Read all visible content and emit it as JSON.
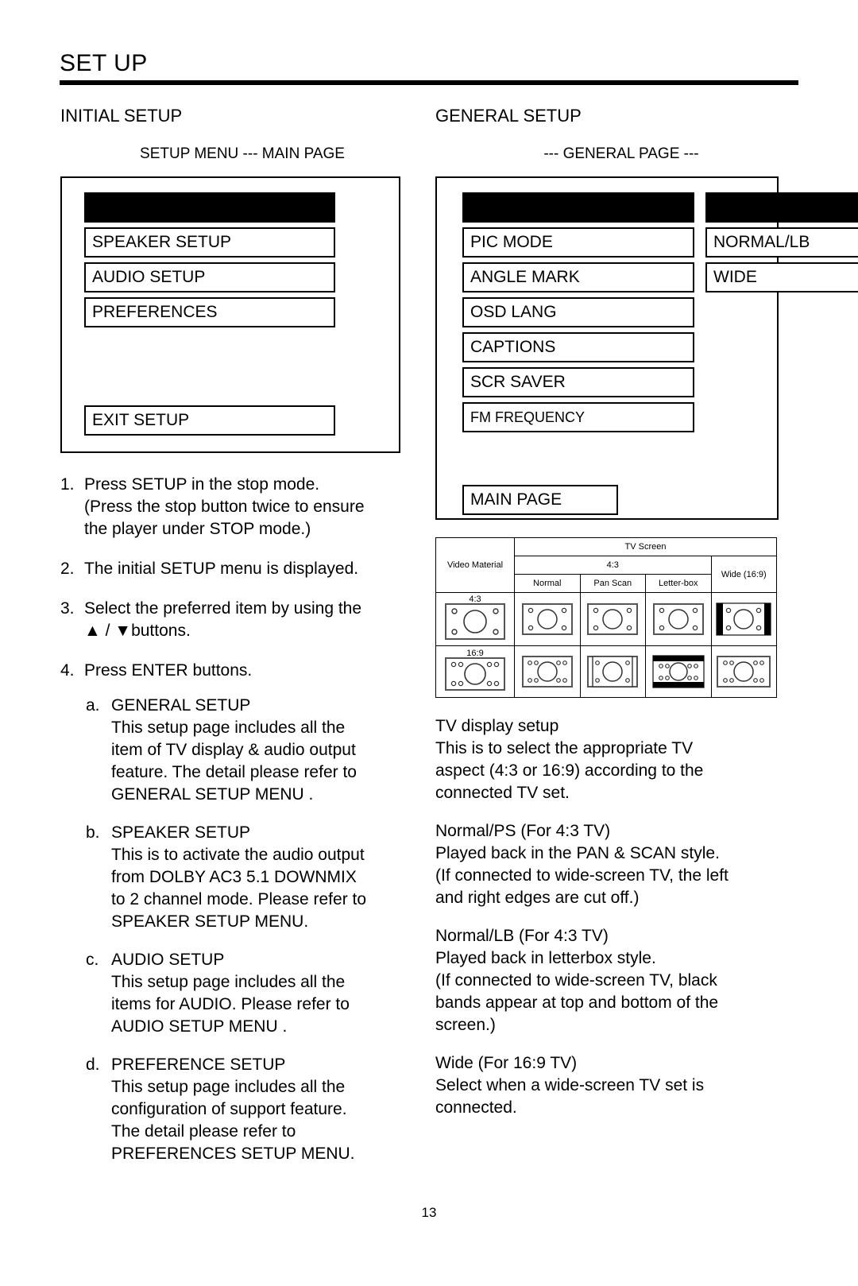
{
  "page": {
    "title": "SET UP",
    "number": "13"
  },
  "left": {
    "section_title": "INITIAL SETUP",
    "sub_title": "SETUP MENU --- MAIN PAGE",
    "osd": {
      "items": [
        "SPEAKER SETUP",
        "AUDIO SETUP",
        "PREFERENCES"
      ],
      "exit": "EXIT SETUP"
    },
    "steps": [
      {
        "num": "1.",
        "lines": [
          "Press SETUP in the stop mode.",
          "(Press the stop button twice to ensure",
          "the player under STOP mode.)"
        ]
      },
      {
        "num": "2.",
        "lines": [
          "The initial SETUP menu is displayed."
        ]
      },
      {
        "num": "3.",
        "lines": [
          "Select the preferred item by using the",
          "▲ / ▼buttons."
        ]
      },
      {
        "num": "4.",
        "lines": [
          "Press ENTER buttons."
        ]
      }
    ],
    "sub_steps": [
      {
        "num": "a.",
        "lines": [
          "GENERAL SETUP",
          "This setup page includes all the",
          "item of TV display & audio output",
          "feature.  The detail please refer to",
          "GENERAL SETUP MENU ."
        ]
      },
      {
        "num": "b.",
        "lines": [
          "SPEAKER SETUP",
          "This is to activate the audio output",
          "from DOLBY AC3 5.1 DOWNMIX",
          "to 2 channel mode.  Please refer to",
          "SPEAKER SETUP MENU."
        ]
      },
      {
        "num": "c.",
        "lines": [
          "AUDIO SETUP",
          "This setup page includes all the",
          "items for AUDIO.  Please refer to",
          "AUDIO SETUP MENU ."
        ]
      },
      {
        "num": "d.",
        "lines": [
          "PREFERENCE SETUP",
          "This setup page includes all the",
          "configuration of support feature.",
          "The detail please refer to",
          "PREFERENCES SETUP MENU."
        ]
      }
    ]
  },
  "right": {
    "section_title": "GENERAL SETUP",
    "sub_title": "--- GENERAL PAGE ---",
    "osd": {
      "items": [
        "PIC MODE",
        "ANGLE MARK",
        "OSD LANG",
        "CAPTIONS",
        "SCR SAVER",
        "FM FREQUENCY"
      ],
      "values": [
        "NORMAL/LB",
        "WIDE"
      ],
      "main_page": "MAIN PAGE"
    },
    "paragraphs": [
      {
        "lines": [
          "TV display setup",
          "This is to select the appropriate TV",
          "aspect (4:3 or 16:9) according to the",
          "connected TV set."
        ]
      },
      {
        "lines": [
          "Normal/PS (For 4:3 TV)",
          "Played back in the PAN & SCAN style.",
          "(If connected to wide-screen TV, the left",
          "and right edges are cut off.)"
        ]
      },
      {
        "lines": [
          "Normal/LB (For 4:3 TV)",
          "Played back in letterbox style.",
          "(If connected to wide-screen TV, black",
          "bands appear at top and bottom of the",
          "screen.)"
        ]
      },
      {
        "lines": [
          "Wide (For 16:9 TV)",
          "Select when a wide-screen TV set is",
          "connected."
        ]
      }
    ]
  },
  "tv_table": {
    "corner_label": "Video Material",
    "screen_header": "TV Screen",
    "group_43": "4:3",
    "group_wide": "Wide (16:9)",
    "sub_headers": [
      "Normal",
      "Pan Scan",
      "Letter-box"
    ],
    "row_labels": [
      "4:3",
      "16:9"
    ]
  },
  "colors": {
    "ink": "#000000",
    "paper": "#ffffff"
  }
}
